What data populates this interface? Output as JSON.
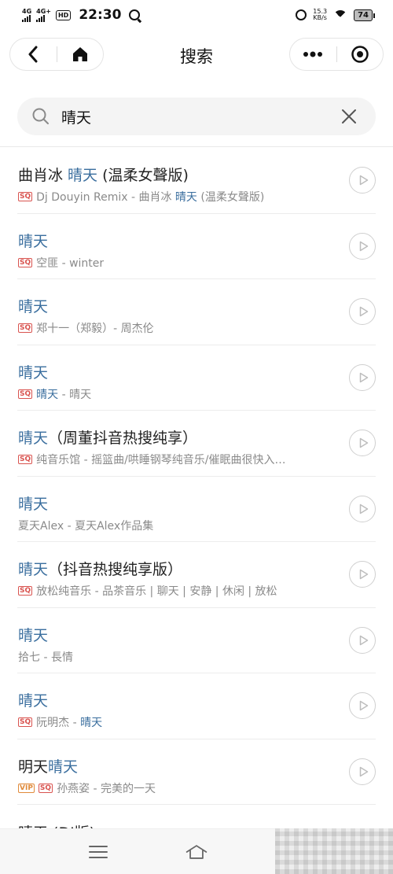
{
  "status_bar": {
    "signal1": "4G",
    "signal2": "4G+",
    "hd": "HD",
    "time": "22:30",
    "speed_value": "15.3",
    "speed_unit": "KB/s",
    "battery": "74"
  },
  "header": {
    "title": "搜索"
  },
  "search": {
    "value": "晴天"
  },
  "results": [
    {
      "title_pre": "曲肖冰 ",
      "title_hl": "晴天",
      "title_post": " (温柔女聲版)",
      "badges": [
        "SQ"
      ],
      "sub_pre": "Dj Douyin Remix - 曲肖冰 ",
      "sub_hl": "晴天",
      "sub_post": " (温柔女聲版)"
    },
    {
      "title_pre": "",
      "title_hl": "晴天",
      "title_post": "",
      "badges": [
        "SQ"
      ],
      "sub_pre": "空匪 - winter",
      "sub_hl": "",
      "sub_post": ""
    },
    {
      "title_pre": "",
      "title_hl": "晴天",
      "title_post": "",
      "badges": [
        "SQ"
      ],
      "sub_pre": "郑十一（郑毅）- 周杰伦",
      "sub_hl": "",
      "sub_post": ""
    },
    {
      "title_pre": "",
      "title_hl": "晴天",
      "title_post": "",
      "badges": [
        "SQ"
      ],
      "sub_pre": "",
      "sub_hl": "晴天",
      "sub_post": " - 晴天"
    },
    {
      "title_pre": "",
      "title_hl": "晴天",
      "title_post": "（周董抖音热搜纯享）",
      "badges": [
        "SQ"
      ],
      "sub_pre": "纯音乐馆 - 摇篮曲/哄睡钢琴纯音乐/催眠曲很快入…",
      "sub_hl": "",
      "sub_post": ""
    },
    {
      "title_pre": "",
      "title_hl": "晴天",
      "title_post": "",
      "badges": [],
      "sub_pre": "夏天Alex - 夏天Alex作品集",
      "sub_hl": "",
      "sub_post": ""
    },
    {
      "title_pre": "",
      "title_hl": "晴天",
      "title_post": "（抖音热搜纯享版）",
      "badges": [
        "SQ"
      ],
      "sub_pre": "放松纯音乐 - 品茶音乐 | 聊天 | 安静 | 休闲 | 放松",
      "sub_hl": "",
      "sub_post": ""
    },
    {
      "title_pre": "",
      "title_hl": "晴天",
      "title_post": "",
      "badges": [],
      "sub_pre": "拾七 - 長情",
      "sub_hl": "",
      "sub_post": ""
    },
    {
      "title_pre": "",
      "title_hl": "晴天",
      "title_post": "",
      "badges": [
        "SQ"
      ],
      "sub_pre": "阮明杰 - ",
      "sub_hl": "晴天",
      "sub_post": ""
    },
    {
      "title_pre": "明天",
      "title_hl": "晴天",
      "title_post": "",
      "badges": [
        "VIP",
        "SQ"
      ],
      "sub_pre": "孙燕姿 - 完美的一天",
      "sub_hl": "",
      "sub_post": ""
    }
  ],
  "partial_row": "晴天 (DJ版)",
  "colors": {
    "highlight": "#3a6e9e",
    "sq_badge": "#d9534f",
    "vip_badge": "#e08a3a"
  },
  "icons": {
    "back": "chevron-left-icon",
    "home": "home-icon",
    "more": "more-dots-icon",
    "target": "target-icon",
    "search": "search-icon",
    "clear": "close-icon",
    "play": "play-icon",
    "menu": "menu-icon",
    "home_bottom": "home-outline-icon"
  }
}
